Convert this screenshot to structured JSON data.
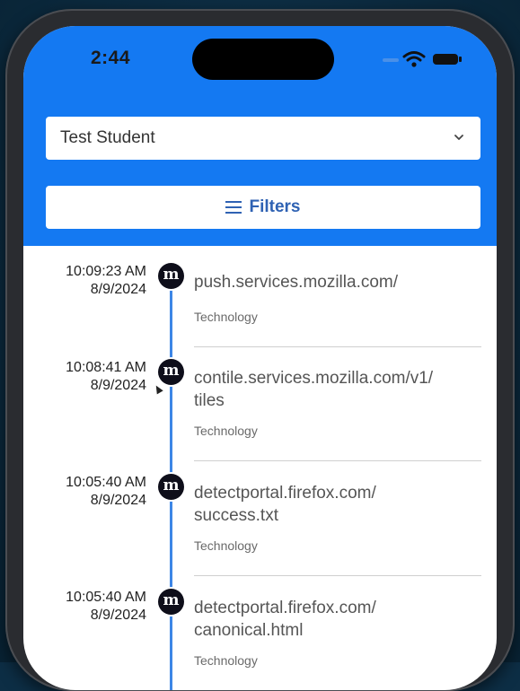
{
  "status_bar": {
    "time": "2:44"
  },
  "student_select": {
    "value": "Test Student",
    "icon": "chevron-down-icon"
  },
  "filters_button": {
    "label": "Filters",
    "icon": "menu-icon"
  },
  "colors": {
    "header_blue": "#1479f2",
    "timeline_blue": "#3d86e6",
    "filters_text": "#2f62b3"
  },
  "history": [
    {
      "time": "10:09:23 AM",
      "date": "8/9/2024",
      "badge_letter": "m",
      "url_line1": "push.services.mozilla.com/",
      "url_line2": "",
      "category": "Technology"
    },
    {
      "time": "10:08:41 AM",
      "date": "8/9/2024",
      "badge_letter": "m",
      "url_line1": "contile.services.mozilla.com/v1/",
      "url_line2": "tiles",
      "category": "Technology"
    },
    {
      "time": "10:05:40 AM",
      "date": "8/9/2024",
      "badge_letter": "m",
      "url_line1": "detectportal.firefox.com/",
      "url_line2": "success.txt",
      "category": "Technology"
    },
    {
      "time": "10:05:40 AM",
      "date": "8/9/2024",
      "badge_letter": "m",
      "url_line1": "detectportal.firefox.com/",
      "url_line2": "canonical.html",
      "category": "Technology"
    }
  ]
}
